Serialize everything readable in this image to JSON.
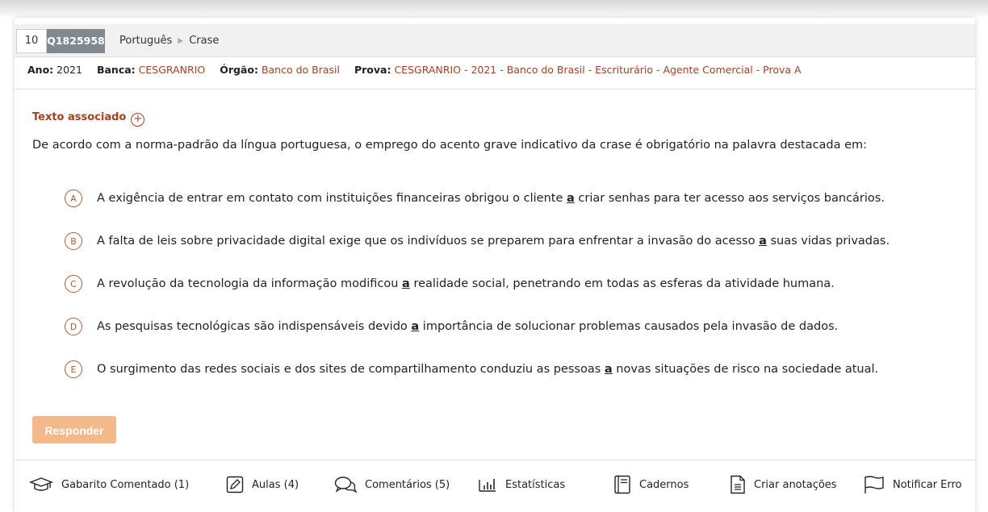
{
  "header": {
    "number": "10",
    "question_id": "Q1825958",
    "breadcrumb": [
      "Português",
      "Crase"
    ]
  },
  "meta": {
    "ano_label": "Ano:",
    "ano_value": "2021",
    "banca_label": "Banca:",
    "banca_value": "CESGRANRIO",
    "orgao_label": "Órgão:",
    "orgao_value": "Banco do Brasil",
    "prova_label": "Prova:",
    "prova_value": "CESGRANRIO - 2021 - Banco do Brasil - Escriturário - Agente Comercial - Prova A"
  },
  "texto_associado": "Texto associado",
  "statement": "De acordo com a norma-padrão da língua portuguesa, o emprego do acento grave indicativo da crase é obrigatório na palavra destacada em:",
  "alternatives": [
    {
      "letter": "A",
      "before": "A exigência de entrar em contato com instituições financeiras obrigou o cliente ",
      "word": "a",
      "after": " criar senhas para ter acesso aos serviços bancários."
    },
    {
      "letter": "B",
      "before": "A falta de leis sobre privacidade digital exige que os indivíduos se preparem para enfrentar a invasão do acesso ",
      "word": "a",
      "after": " suas vidas privadas."
    },
    {
      "letter": "C",
      "before": "A revolução da tecnologia da informação modificou ",
      "word": "a",
      "after": " realidade social, penetrando em todas as esferas da atividade humana."
    },
    {
      "letter": "D",
      "before": "As pesquisas tecnológicas são indispensáveis devido ",
      "word": "a",
      "after": " importância de solucionar problemas causados pela invasão de dados."
    },
    {
      "letter": "E",
      "before": "O surgimento das redes sociais e dos sites de compartilhamento conduziu as pessoas ",
      "word": "a",
      "after": " novas situações de risco na sociedade atual."
    }
  ],
  "responder_label": "Responder",
  "footer": {
    "gabarito": "Gabarito Comentado (1)",
    "aulas": "Aulas (4)",
    "comentarios": "Comentários (5)",
    "estatisticas": "Estatísticas",
    "cadernos": "Cadernos",
    "anotacoes": "Criar anotações",
    "notificar": "Notificar Erro"
  },
  "colors": {
    "accent": "#a8401e",
    "button": "#f4b98a",
    "id_badge": "#808890"
  },
  "icons": [
    "plus-circle-icon",
    "graduation-cap-icon",
    "pencil-icon",
    "chat-bubbles-icon",
    "bar-chart-icon",
    "notebook-icon",
    "document-icon",
    "flag-icon"
  ]
}
